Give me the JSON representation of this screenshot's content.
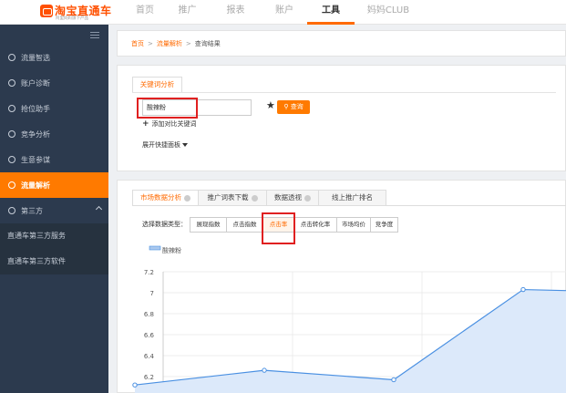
{
  "app": {
    "logo_title": "淘宝直通车",
    "logo_subtitle": "阿里妈妈旗下产品"
  },
  "topnav": {
    "items": [
      {
        "label": "首页",
        "active": false
      },
      {
        "label": "推广",
        "active": false
      },
      {
        "label": "报表",
        "active": false
      },
      {
        "label": "账户",
        "active": false
      },
      {
        "label": "工具",
        "active": true
      },
      {
        "label": "妈妈CLUB",
        "active": false
      }
    ]
  },
  "sidebar": {
    "items": [
      {
        "label": "流量智选",
        "icon": "compass-icon",
        "active": false
      },
      {
        "label": "账户诊断",
        "icon": "diagnose-icon",
        "active": false
      },
      {
        "label": "抢位助手",
        "icon": "target-icon",
        "active": false
      },
      {
        "label": "竞争分析",
        "icon": "bar-chart-icon",
        "active": false
      },
      {
        "label": "生意参谋",
        "icon": "advisor-icon",
        "active": false
      },
      {
        "label": "流量解析",
        "icon": "analysis-icon",
        "active": true
      },
      {
        "label": "第三方",
        "icon": "third-party-icon",
        "active": false
      }
    ],
    "subitems": [
      {
        "label": "直通车第三方服务"
      },
      {
        "label": "直通车第三方软件"
      }
    ]
  },
  "breadcrumb": {
    "home": "首页",
    "section": "流量解析",
    "current": "查询结果"
  },
  "keyword_panel": {
    "tab_label": "关键词分析",
    "input_value": "酸辣粉",
    "query_button": "查询",
    "add_compare": "添加对比关键词",
    "expand_panel": "展开快捷面板"
  },
  "market_panel": {
    "tabs": [
      {
        "label": "市场数据分析",
        "active": true
      },
      {
        "label": "推广词表下载",
        "active": false
      },
      {
        "label": "数据透视",
        "active": false
      },
      {
        "label": "线上推广排名",
        "active": false
      }
    ],
    "data_type_label": "选择数据类型：",
    "data_types": [
      {
        "label": "展现指数",
        "active": false
      },
      {
        "label": "点击指数",
        "active": false
      },
      {
        "label": "点击率",
        "active": true
      },
      {
        "label": "点击转化率",
        "active": false
      },
      {
        "label": "市场均价",
        "active": false
      },
      {
        "label": "竞争度",
        "active": false
      }
    ]
  },
  "colors": {
    "accent": "#ff6a00",
    "sidebar_bg": "#2c3a4e",
    "highlight": "#e02020",
    "series": "#4a90e2"
  },
  "chart_data": {
    "type": "area",
    "title": "",
    "xlabel": "",
    "ylabel": "",
    "yticks": [
      "7.2",
      "7",
      "6.8",
      "6.6",
      "6.4",
      "6.2"
    ],
    "ylim": [
      6.0,
      7.2
    ],
    "grid": true,
    "legend": "top-left",
    "series": [
      {
        "name": "酸辣粉",
        "x": [
          0,
          1,
          2,
          3,
          4
        ],
        "values": [
          6.12,
          6.26,
          6.17,
          7.03,
          7.0
        ]
      }
    ]
  }
}
